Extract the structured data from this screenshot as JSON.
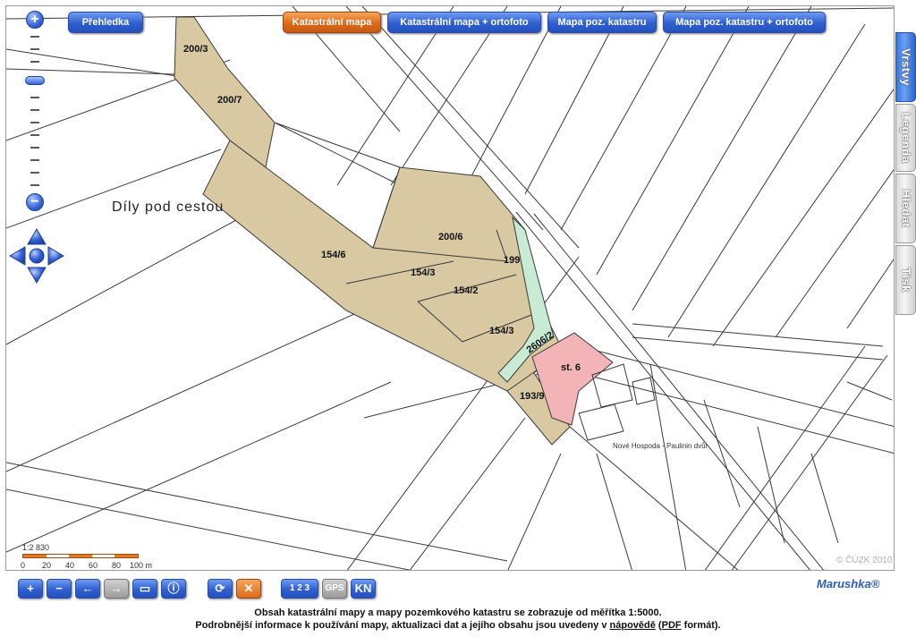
{
  "overview_button": "Přehledka",
  "map_tabs": [
    {
      "label": "Katastrální mapa",
      "active": true
    },
    {
      "label": "Katastrální mapa + ortofoto",
      "active": false
    },
    {
      "label": "Mapa poz. katastru",
      "active": false
    },
    {
      "label": "Mapa poz. katastru + ortofoto",
      "active": false
    }
  ],
  "side_tabs": [
    {
      "label": "Vrstvy",
      "active": true
    },
    {
      "label": "Legenda",
      "active": false
    },
    {
      "label": "Hledat",
      "active": false
    },
    {
      "label": "Tisk",
      "active": false
    }
  ],
  "zoom": {
    "in_symbol": "+",
    "out_symbol": "−"
  },
  "map": {
    "locality_name": "Díly pod cestou",
    "street_label": "Nové Hospoda - Paulinin dvůr",
    "parcels": [
      {
        "id": "200/3",
        "type": "land"
      },
      {
        "id": "200/7",
        "type": "land"
      },
      {
        "id": "200/6",
        "type": "land"
      },
      {
        "id": "154/6",
        "type": "land"
      },
      {
        "id": "154/3",
        "type": "land"
      },
      {
        "id": "154/2",
        "type": "land"
      },
      {
        "id": "154/3",
        "type": "land"
      },
      {
        "id": "199",
        "type": "land"
      },
      {
        "id": "2606/2",
        "type": "road"
      },
      {
        "id": "193/9",
        "type": "land"
      },
      {
        "id": "st. 6",
        "type": "building"
      }
    ],
    "colors": {
      "land": "#d8c9a3",
      "road": "#c8ecd3",
      "building": "#f3b4b8",
      "lines": "#3a3a3a"
    }
  },
  "scale": {
    "ratio": "1:2 830",
    "labels": [
      "0",
      "20",
      "40",
      "60",
      "80",
      "100 m"
    ]
  },
  "copyright": "© ČÚZK 2010",
  "toolbar": {
    "buttons": [
      {
        "name": "zoom-in",
        "symbol": "+"
      },
      {
        "name": "zoom-out",
        "symbol": "−"
      },
      {
        "name": "back",
        "symbol": "←"
      },
      {
        "name": "forward",
        "symbol": "→"
      },
      {
        "name": "zoom-box",
        "symbol": "▭"
      },
      {
        "name": "info",
        "symbol": "ⓘ"
      },
      {
        "name": "refresh",
        "symbol": "⟳"
      },
      {
        "name": "clear",
        "symbol": "✕"
      },
      {
        "name": "measure",
        "symbol": "1 2 3"
      },
      {
        "name": "gps",
        "symbol": "GPS"
      },
      {
        "name": "kn",
        "symbol": "KN"
      }
    ],
    "brand": "Marushka®"
  },
  "footer": {
    "line1": "Obsah katastrální mapy a mapy pozemkového katastru se zobrazuje od měřítka 1:5000.",
    "line2_before": "Podrobnější informace k používání mapy, aktualizaci dat a jejího obsahu jsou uvedeny v ",
    "help_link": "nápovědě",
    "line2_middle": " (",
    "pdf_link": "PDF",
    "line2_after": " formát)."
  }
}
